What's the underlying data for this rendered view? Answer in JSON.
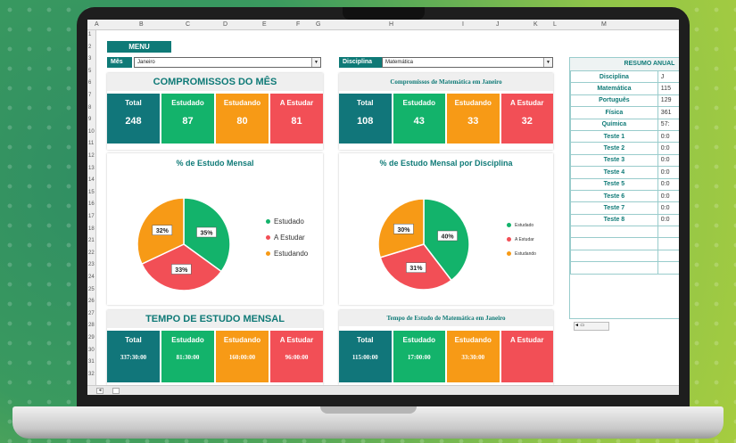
{
  "sheet": {
    "columns": [
      "A",
      "B",
      "C",
      "D",
      "E",
      "F",
      "G",
      "H",
      "I",
      "J",
      "K",
      "L",
      "M"
    ],
    "rows": [
      "1",
      "2",
      "3",
      "5",
      "6",
      "7",
      "8",
      "9",
      "10",
      "11",
      "12",
      "13",
      "14",
      "15",
      "16",
      "17",
      "18",
      "21",
      "22",
      "23",
      "24",
      "25",
      "26",
      "27",
      "28",
      "29",
      "30",
      "31",
      "32"
    ]
  },
  "menu": {
    "label": "MENU"
  },
  "filters": {
    "mes_label": "Mês",
    "mes_value": "Janeiro",
    "disciplina_label": "Disciplina",
    "disciplina_value": "Matemática"
  },
  "left": {
    "title": "COMPROMISSOS DO MÊS",
    "kpis": [
      {
        "label": "Total",
        "value": "248"
      },
      {
        "label": "Estudado",
        "value": "87"
      },
      {
        "label": "Estudando",
        "value": "80"
      },
      {
        "label": "A Estudar",
        "value": "81"
      }
    ],
    "chart_title": "% de Estudo Mensal",
    "time_title": "TEMPO DE ESTUDO MENSAL",
    "time_kpis": [
      {
        "label": "Total",
        "value": "337:30:00"
      },
      {
        "label": "Estudado",
        "value": "81:30:00"
      },
      {
        "label": "Estudando",
        "value": "160:00:00"
      },
      {
        "label": "A Estudar",
        "value": "96:00:00"
      }
    ]
  },
  "right": {
    "title": "Compromissos de Matemática em Janeiro",
    "kpis": [
      {
        "label": "Total",
        "value": "108"
      },
      {
        "label": "Estudado",
        "value": "43"
      },
      {
        "label": "Estudando",
        "value": "33"
      },
      {
        "label": "A Estudar",
        "value": "32"
      }
    ],
    "chart_title": "% de Estudo Mensal por Disciplina",
    "time_title": "Tempo de Estudo de Matemática em Janeiro",
    "time_kpis": [
      {
        "label": "Total",
        "value": "115:00:00"
      },
      {
        "label": "Estudado",
        "value": "17:00:00"
      },
      {
        "label": "Estudando",
        "value": "33:30:00"
      },
      {
        "label": "A Estudar",
        "value": ""
      }
    ]
  },
  "colors": {
    "total": "#11767a",
    "estudado": "#13b36b",
    "estudando": "#f79a16",
    "a_estudar": "#f24f56"
  },
  "chart_data": [
    {
      "type": "pie",
      "title": "% de Estudo Mensal",
      "categories": [
        "Estudado",
        "A Estudar",
        "Estudando"
      ],
      "values": [
        35,
        33,
        32
      ],
      "labels": [
        "35%",
        "33%",
        "32%"
      ],
      "legend": "right"
    },
    {
      "type": "pie",
      "title": "% de Estudo Mensal por Disciplina",
      "categories": [
        "Estudado",
        "A Estudar",
        "Estudando"
      ],
      "values": [
        40,
        31,
        30
      ],
      "labels": [
        "40%",
        "31%",
        "30%"
      ],
      "legend": "right"
    }
  ],
  "resumo": {
    "title": "RESUMO ANUAL",
    "header_col": "Disciplina",
    "header_val": "J",
    "rows": [
      {
        "name": "Matemática",
        "val": "115"
      },
      {
        "name": "Português",
        "val": "129"
      },
      {
        "name": "Física",
        "val": "361"
      },
      {
        "name": "Química",
        "val": "57:"
      },
      {
        "name": "Teste 1",
        "val": "0:0"
      },
      {
        "name": "Teste 2",
        "val": "0:0"
      },
      {
        "name": "Teste 3",
        "val": "0:0"
      },
      {
        "name": "Teste 4",
        "val": "0:0"
      },
      {
        "name": "Teste 5",
        "val": "0:0"
      },
      {
        "name": "Teste 6",
        "val": "0:0"
      },
      {
        "name": "Teste 7",
        "val": "0:0"
      },
      {
        "name": "Teste 8",
        "val": "0:0"
      },
      {
        "name": "",
        "val": ""
      },
      {
        "name": "",
        "val": ""
      },
      {
        "name": "",
        "val": ""
      },
      {
        "name": "",
        "val": ""
      }
    ]
  }
}
